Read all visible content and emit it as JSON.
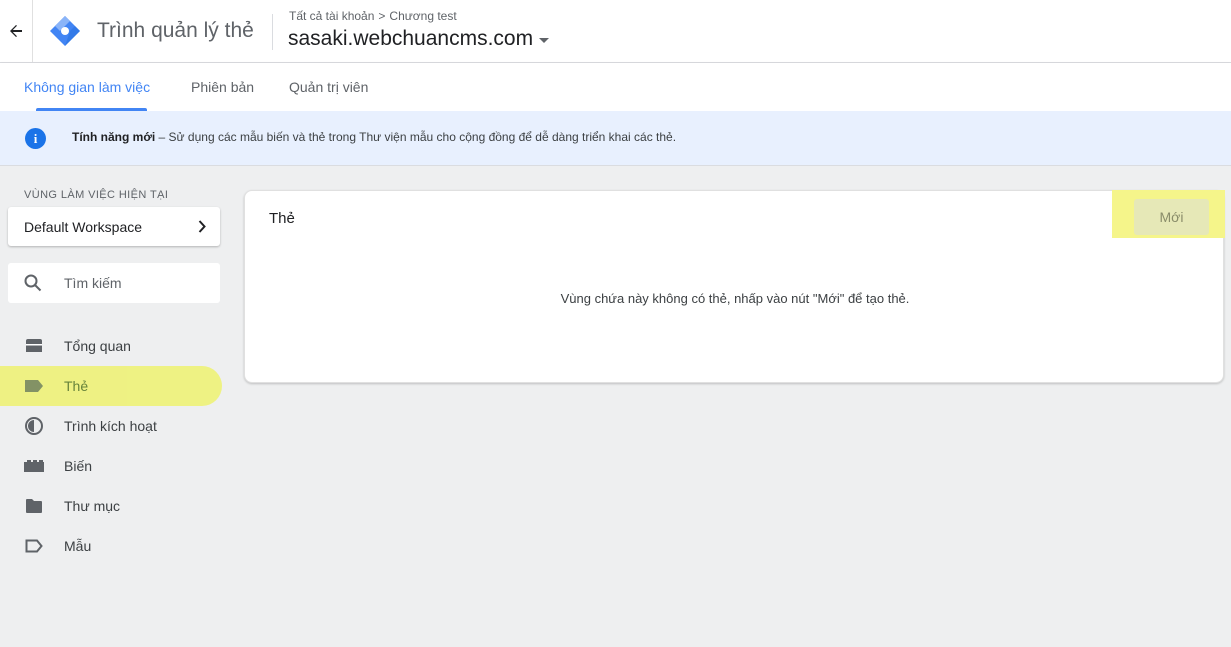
{
  "header": {
    "app_title": "Trình quản lý thẻ",
    "breadcrumb_account": "Tất cả tài khoản",
    "breadcrumb_sep": ">",
    "breadcrumb_container": "Chương test",
    "container_name": "sasaki.webchuancms.com"
  },
  "tabs": [
    {
      "label": "Không gian làm việc",
      "active": true
    },
    {
      "label": "Phiên bản",
      "active": false
    },
    {
      "label": "Quản trị viên",
      "active": false
    }
  ],
  "notice": {
    "bold": "Tính năng mới",
    "text": " – Sử dụng các mẫu biến và thẻ trong Thư viện mẫu cho cộng đồng để dễ dàng triển khai các thẻ."
  },
  "sidebar": {
    "workspace_label": "VÙNG LÀM VIỆC HIỆN TẠI",
    "workspace_name": "Default Workspace",
    "search_placeholder": "Tìm kiếm",
    "items": [
      {
        "label": "Tổng quan",
        "icon": "overview-icon"
      },
      {
        "label": "Thẻ",
        "icon": "tag-icon",
        "active": true
      },
      {
        "label": "Trình kích hoạt",
        "icon": "trigger-icon"
      },
      {
        "label": "Biến",
        "icon": "variable-icon"
      },
      {
        "label": "Thư mục",
        "icon": "folder-icon"
      },
      {
        "label": "Mẫu",
        "icon": "template-icon"
      }
    ]
  },
  "main": {
    "card_title": "Thẻ",
    "new_button": "Mới",
    "empty_message": "Vùng chứa này không có thẻ, nhấp vào nút \"Mới\" để tạo thẻ."
  },
  "colors": {
    "accent": "#4285f4",
    "highlight": "#eef27a",
    "notice_bg": "#e8f0fe",
    "page_bg": "#eeeff0"
  }
}
